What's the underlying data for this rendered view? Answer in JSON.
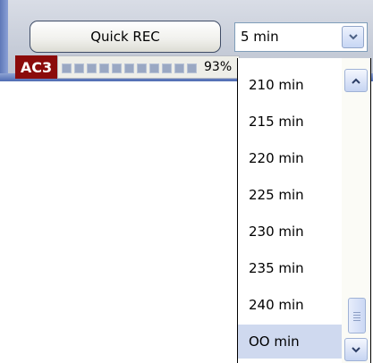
{
  "toolbar": {
    "quick_rec_label": "Quick REC",
    "audio_format": "AC3",
    "level_percent": "93%",
    "level_fraction": 0.93
  },
  "duration_select": {
    "selected": "5 min",
    "arrow_icon": "chevron-down-icon"
  },
  "dropdown": {
    "options": [
      "210 min",
      "215 min",
      "220 min",
      "225 min",
      "230 min",
      "235 min",
      "240 min",
      "OO min"
    ],
    "highlighted": "OO min"
  },
  "colors": {
    "badge": "#8b0b0b",
    "highlight": "#cfd9ef"
  }
}
